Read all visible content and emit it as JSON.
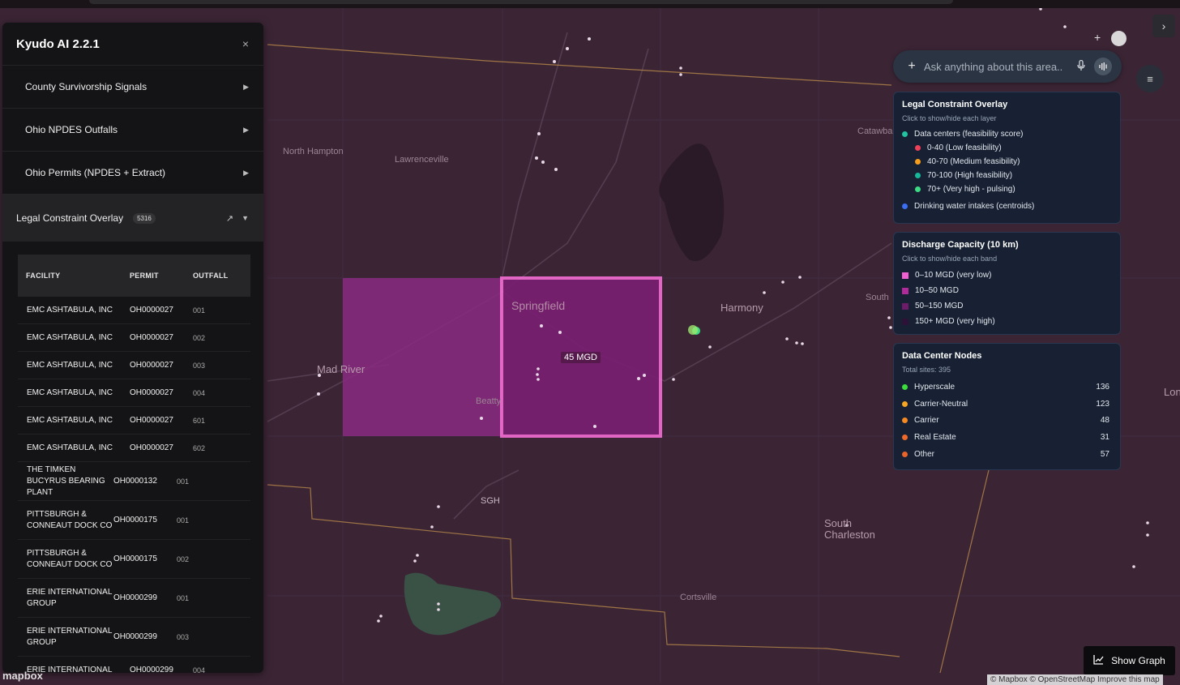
{
  "sidebar": {
    "title": "Kyudo AI 2.2.1",
    "close_label": "×",
    "items": [
      {
        "label": "County Survivorship Signals",
        "arrow": "▶"
      },
      {
        "label": "Ohio NPDES Outfalls",
        "arrow": "▶"
      },
      {
        "label": "Ohio Permits (NPDES + Extract)",
        "arrow": "▶"
      }
    ],
    "active": {
      "label": "Legal Constraint Overlay",
      "badge": "5316",
      "external": "↗",
      "caret": "▼"
    },
    "table": {
      "headers": [
        "FACILITY",
        "PERMIT",
        "OUTFALL"
      ],
      "rows": [
        {
          "facility": "EMC ASHTABULA, INC",
          "permit": "OH0000027",
          "outfall": "001"
        },
        {
          "facility": "EMC ASHTABULA, INC",
          "permit": "OH0000027",
          "outfall": "002"
        },
        {
          "facility": "EMC ASHTABULA, INC",
          "permit": "OH0000027",
          "outfall": "003"
        },
        {
          "facility": "EMC ASHTABULA, INC",
          "permit": "OH0000027",
          "outfall": "004"
        },
        {
          "facility": "EMC ASHTABULA, INC",
          "permit": "OH0000027",
          "outfall": "601"
        },
        {
          "facility": "EMC ASHTABULA, INC",
          "permit": "OH0000027",
          "outfall": "602"
        },
        {
          "facility": "THE TIMKEN BUCYRUS BEARING PLANT",
          "permit": "OH0000132",
          "outfall": "001"
        },
        {
          "facility": "PITTSBURGH & CONNEAUT DOCK CO",
          "permit": "OH0000175",
          "outfall": "001"
        },
        {
          "facility": "PITTSBURGH & CONNEAUT DOCK CO",
          "permit": "OH0000175",
          "outfall": "002"
        },
        {
          "facility": "ERIE INTERNATIONAL GROUP",
          "permit": "OH0000299",
          "outfall": "001"
        },
        {
          "facility": "ERIE INTERNATIONAL GROUP",
          "permit": "OH0000299",
          "outfall": "003"
        },
        {
          "facility": "ERIE INTERNATIONAL",
          "permit": "OH0000299",
          "outfall": "004"
        }
      ]
    }
  },
  "search": {
    "placeholder": "Ask anything about this area..",
    "plus": "+",
    "mic": "🎙"
  },
  "menu_icon": "≡",
  "collapse_icon": "›",
  "top_plus": "+",
  "legal_panel": {
    "title": "Legal Constraint Overlay",
    "subtitle": "Click to show/hide each layer",
    "group": {
      "label": "Data centers (feasibility score)",
      "color": "#22c3a0"
    },
    "bands": [
      {
        "label": "0-40 (Low feasibility)",
        "color": "#ef4058"
      },
      {
        "label": "40-70 (Medium feasibility)",
        "color": "#f59e1b"
      },
      {
        "label": "70-100 (High feasibility)",
        "color": "#18b79a"
      },
      {
        "label": "70+ (Very high - pulsing)",
        "color": "#3ddc84"
      }
    ],
    "intakes": {
      "label": "Drinking water intakes (centroids)",
      "color": "#3b6ef0"
    }
  },
  "discharge_panel": {
    "title": "Discharge Capacity (10 km)",
    "subtitle": "Click to show/hide each band",
    "bands": [
      {
        "label": "0–10 MGD (very low)",
        "color": "#f25fd0"
      },
      {
        "label": "10–50 MGD",
        "color": "#b02a9a"
      },
      {
        "label": "50–150 MGD",
        "color": "#6e1b6a"
      },
      {
        "label": "150+ MGD (very high)",
        "color": "#2c1236"
      }
    ]
  },
  "nodes_panel": {
    "title": "Data Center Nodes",
    "subtitle": "Total sites: 395",
    "items": [
      {
        "label": "Hyperscale",
        "count": "136",
        "color": "#3ddc3d"
      },
      {
        "label": "Carrier-Neutral",
        "count": "123",
        "color": "#f5a623"
      },
      {
        "label": "Carrier",
        "count": "48",
        "color": "#f58a23"
      },
      {
        "label": "Real Estate",
        "count": "31",
        "color": "#ef6a2a"
      },
      {
        "label": "Other",
        "count": "57",
        "color": "#e8642a"
      }
    ]
  },
  "map": {
    "places": [
      "North Hampton",
      "Lawrenceville",
      "Catawba",
      "Harmony",
      "Springfield",
      "Mad River",
      "Beatty",
      "SGH",
      "South Charleston",
      "Cortsville",
      "South",
      "Lon"
    ],
    "selected_capacity": "45 MGD",
    "show_graph": "Show Graph",
    "attribution": "© Mapbox © OpenStreetMap  Improve this map",
    "logo": "mapbox"
  }
}
